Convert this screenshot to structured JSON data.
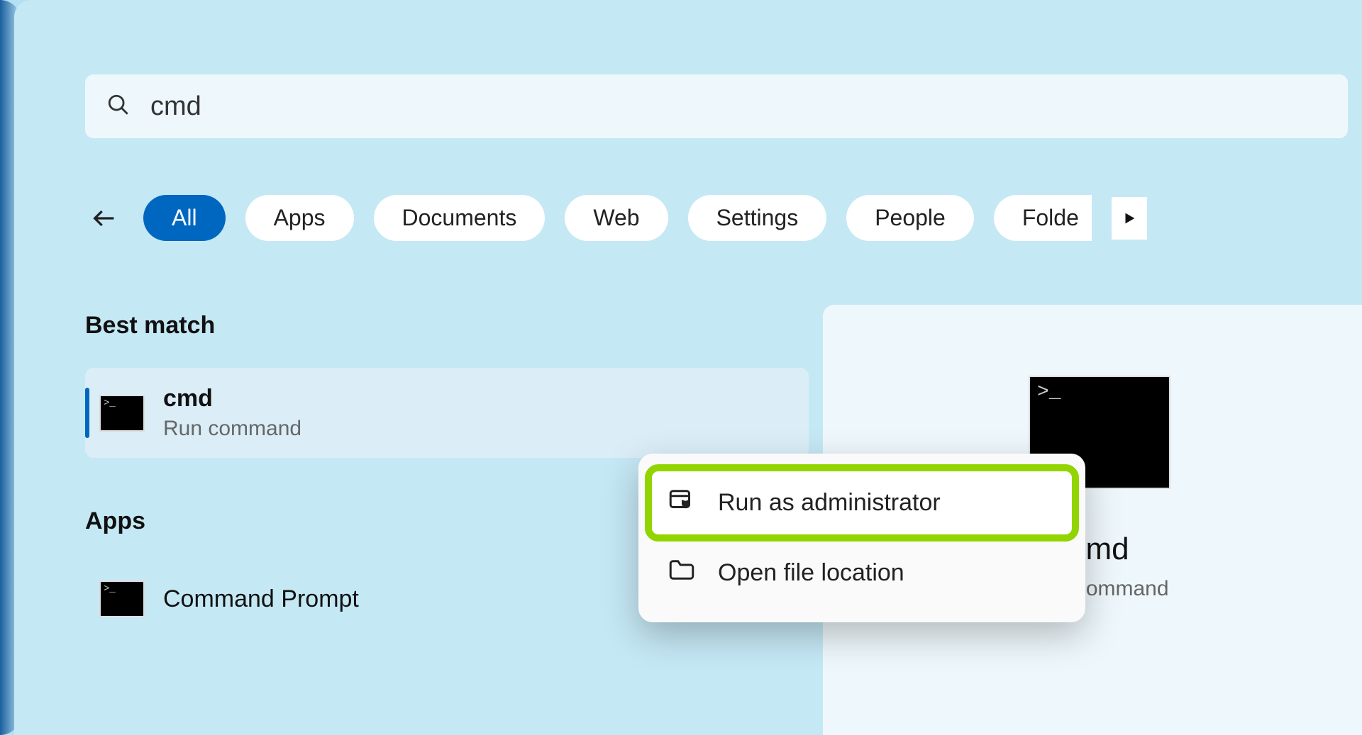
{
  "search": {
    "query": "cmd"
  },
  "filters": {
    "items": [
      "All",
      "Apps",
      "Documents",
      "Web",
      "Settings",
      "People",
      "Folde"
    ],
    "active_index": 0
  },
  "sections": {
    "best_match_header": "Best match",
    "apps_header": "Apps"
  },
  "best_match": {
    "title": "cmd",
    "subtitle": "Run command"
  },
  "apps": {
    "item0_title": "Command Prompt"
  },
  "context_menu": {
    "run_as_admin": "Run as administrator",
    "open_file_location": "Open file location"
  },
  "detail": {
    "title": "cmd",
    "subtitle": "Run command"
  }
}
